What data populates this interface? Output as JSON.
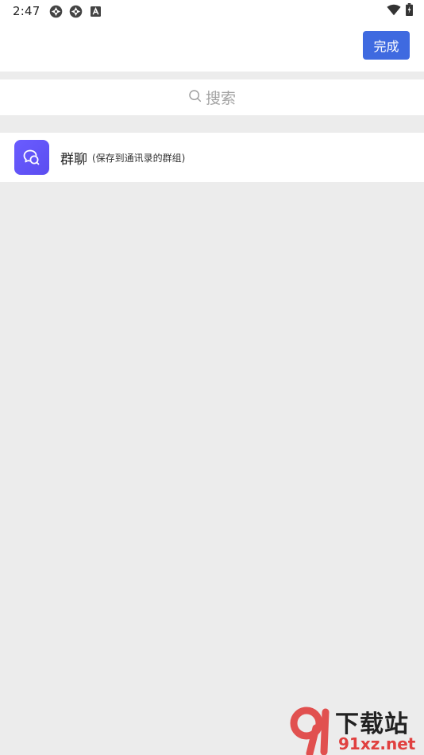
{
  "status_bar": {
    "time": "2:47",
    "icons": [
      "aperture-icon",
      "aperture-icon",
      "font-a-icon",
      "wifi-icon",
      "battery-charging-icon"
    ]
  },
  "toolbar": {
    "done_label": "完成"
  },
  "search": {
    "placeholder": "搜索"
  },
  "list": {
    "items": [
      {
        "icon": "group-chat-icon",
        "title": "群聊",
        "subtitle": "(保存到通讯录的群组)"
      }
    ]
  },
  "watermark": {
    "logo_number": "91",
    "brand": "下载站",
    "domain": "91xz.net"
  },
  "colors": {
    "accent": "#3f6ae0",
    "avatar": "#5b4df0",
    "background": "#ececec",
    "watermark_red": "#e0403f"
  }
}
